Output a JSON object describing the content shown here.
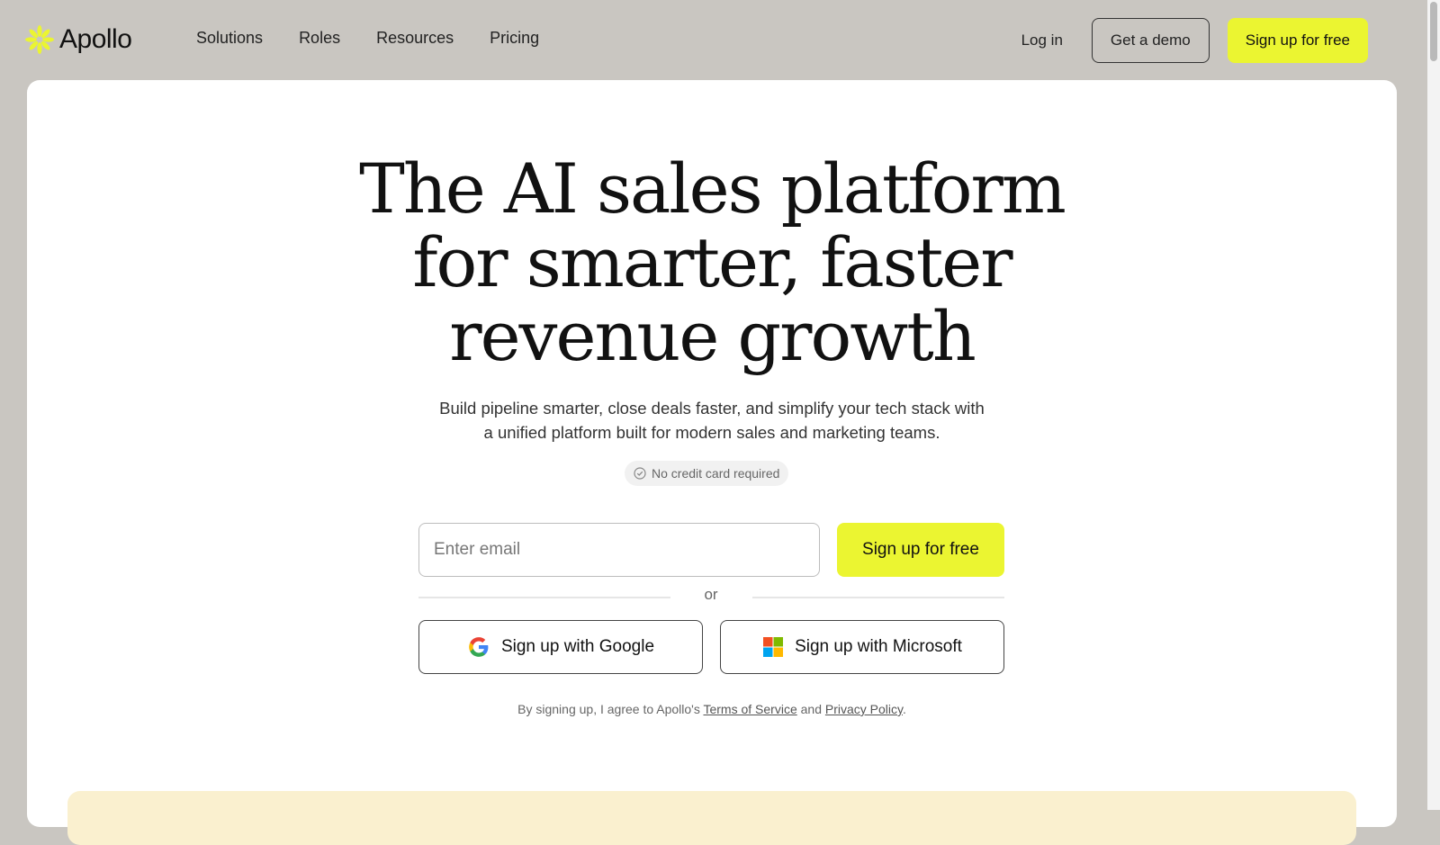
{
  "brand": {
    "name": "Apollo",
    "logo_color": "#ebf531"
  },
  "nav": {
    "items": [
      "Solutions",
      "Roles",
      "Resources",
      "Pricing"
    ]
  },
  "header_actions": {
    "login": "Log in",
    "demo": "Get a demo",
    "signup": "Sign up for free"
  },
  "hero": {
    "headline_lines": [
      "The AI sales platform",
      "for smarter, faster",
      "revenue growth"
    ],
    "subtitle_lines": [
      "Build pipeline smarter, close deals faster, and simplify your tech stack with",
      "a unified platform built for modern sales and marketing teams."
    ],
    "badge": "No credit card required"
  },
  "form": {
    "email_placeholder": "Enter email",
    "email_value": "",
    "signup_label": "Sign up for free",
    "or_label": "or",
    "google_label": "Sign up with Google",
    "microsoft_label": "Sign up with Microsoft"
  },
  "legal": {
    "prefix": "By signing up, I agree to Apollo's ",
    "terms": "Terms of Service",
    "middle": " and ",
    "privacy": "Privacy Policy",
    "suffix": "."
  },
  "colors": {
    "accent_yellow": "#ebf531",
    "page_bg": "#c9c6c1",
    "card_bg": "#ffffff",
    "strip_bg": "#faf0cf"
  },
  "icons": {
    "logo": "sunburst-logo-icon",
    "badge": "check-circle-icon",
    "google": "google-icon",
    "microsoft": "microsoft-icon"
  }
}
